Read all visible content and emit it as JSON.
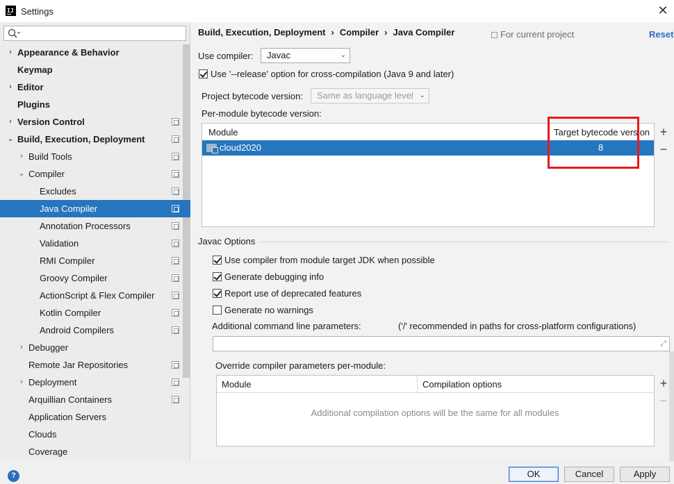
{
  "window": {
    "title": "Settings"
  },
  "sidebar": {
    "search_placeholder": "",
    "items": [
      {
        "label": "Appearance & Behavior",
        "arrow": "›",
        "bold": true
      },
      {
        "label": "Keymap",
        "arrow": "",
        "bold": true
      },
      {
        "label": "Editor",
        "arrow": "›",
        "bold": true
      },
      {
        "label": "Plugins",
        "arrow": "",
        "bold": true
      },
      {
        "label": "Version Control",
        "arrow": "›",
        "bold": true
      },
      {
        "label": "Build, Execution, Deployment",
        "arrow": "⌄",
        "bold": true
      },
      {
        "label": "Build Tools",
        "arrow": "›"
      },
      {
        "label": "Compiler",
        "arrow": "⌄"
      },
      {
        "label": "Excludes",
        "arrow": ""
      },
      {
        "label": "Java Compiler",
        "arrow": "",
        "selected": true
      },
      {
        "label": "Annotation Processors",
        "arrow": ""
      },
      {
        "label": "Validation",
        "arrow": ""
      },
      {
        "label": "RMI Compiler",
        "arrow": ""
      },
      {
        "label": "Groovy Compiler",
        "arrow": ""
      },
      {
        "label": "ActionScript & Flex Compiler",
        "arrow": ""
      },
      {
        "label": "Kotlin Compiler",
        "arrow": ""
      },
      {
        "label": "Android Compilers",
        "arrow": ""
      },
      {
        "label": "Debugger",
        "arrow": "›"
      },
      {
        "label": "Remote Jar Repositories",
        "arrow": ""
      },
      {
        "label": "Deployment",
        "arrow": "›"
      },
      {
        "label": "Arquillian Containers",
        "arrow": ""
      },
      {
        "label": "Application Servers",
        "arrow": ""
      },
      {
        "label": "Clouds",
        "arrow": ""
      },
      {
        "label": "Coverage",
        "arrow": ""
      }
    ]
  },
  "header": {
    "breadcrumb": [
      "Build, Execution, Deployment",
      "Compiler",
      "Java Compiler"
    ],
    "breadcrumb_sep": "›",
    "for_current_project": "For current project",
    "reset": "Reset"
  },
  "compiler": {
    "use_compiler_label": "Use compiler:",
    "use_compiler_value": "Javac",
    "release_option_label": "Use '--release' option for cross-compilation (Java 9 and later)",
    "release_option_checked": true,
    "project_bytecode_label": "Project bytecode version:",
    "project_bytecode_value": "Same as language level",
    "per_module_label": "Per-module bytecode version:",
    "module_table": {
      "columns": [
        "Module",
        "Target bytecode version"
      ],
      "rows": [
        {
          "module": "cloud2020",
          "version": "8"
        }
      ]
    }
  },
  "javac": {
    "section_title": "Javac Options",
    "options": [
      {
        "label": "Use compiler from module target JDK when possible",
        "checked": true
      },
      {
        "label": "Generate debugging info",
        "checked": true
      },
      {
        "label": "Report use of deprecated features",
        "checked": true
      },
      {
        "label": "Generate no warnings",
        "checked": false
      }
    ],
    "additional_params_label": "Additional command line parameters:",
    "additional_params_hint": "('/' recommended in paths for cross-platform configurations)",
    "additional_params_value": "",
    "override_label": "Override compiler parameters per-module:",
    "override_table": {
      "columns": [
        "Module",
        "Compilation options"
      ],
      "empty_text": "Additional compilation options will be the same for all modules"
    }
  },
  "buttons": {
    "ok": "OK",
    "cancel": "Cancel",
    "apply": "Apply",
    "help": "?"
  },
  "icons": {
    "plus": "+",
    "minus": "−",
    "dropdown_arrow": "⌄",
    "expand": "⤢",
    "close": "✕"
  },
  "colors": {
    "selection": "#2675bf",
    "link": "#2a6ebf",
    "highlight_box": "#e8181e"
  }
}
